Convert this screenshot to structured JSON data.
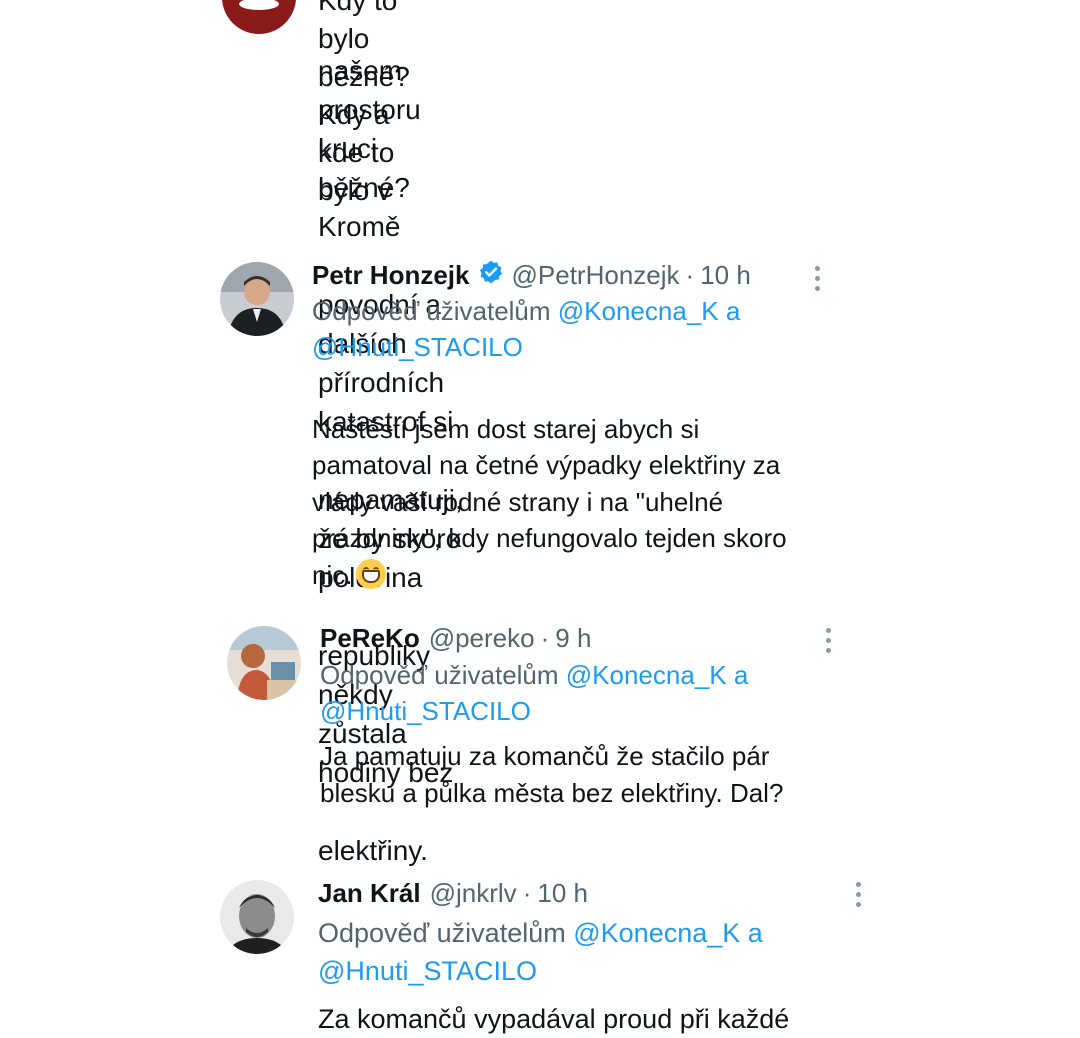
{
  "tweet0": {
    "avatar_label": "STAČILO!",
    "partial_first_line": "Kdy to bylo běžné? Kdy a kde to bylo v",
    "body_lines": [
      "našem prostoru kruci běžné? Kromě",
      "povodní a dalších přírodních katastrof si",
      "nepamatuji, že by skoro polovina",
      "republiky někdy zůstala hodiny bez",
      "elektřiny."
    ]
  },
  "tweet1": {
    "name": "Petr Honzejk",
    "handle": "@PetrHonzejk",
    "dot": "·",
    "time": "10 h",
    "reply_prefix": "Odpověď uživatelům",
    "mention1": "@Konecna_K",
    "conj": "a",
    "mention2": "@Hnuti_STACILO",
    "body": "Naštěstí jsem dost starej abych si\npamatoval na četné výpadky elektřiny za\nvlády vaší rodné strany i na \"uhelné\nprázdniny\", kdy nefungovalo tejden skoro\nnic.",
    "emoji_icon": "grinning-face-emoji"
  },
  "tweet2": {
    "name": "PeReKo",
    "handle": "@pereko",
    "dot": "·",
    "time": "9 h",
    "reply_prefix": "Odpověď uživatelům",
    "mention1": "@Konecna_K",
    "conj": "a",
    "mention2": "@Hnuti_STACILO",
    "body": "Ja pamatuju za komančů že stačilo pár\nblesku a půlka města bez elektřiny. Dal?"
  },
  "tweet3": {
    "name": "Jan Král",
    "handle": "@jnkrlv",
    "dot": "·",
    "time": "10 h",
    "reply_prefix": "Odpověď uživatelům",
    "mention1": "@Konecna_K",
    "conj": "a",
    "mention2": "@Hnuti_STACILO",
    "body_partial": "Za komančů vypadával proud při každé"
  },
  "colors": {
    "text": "#0f1419",
    "secondary": "#536471",
    "link": "#1d9bf0",
    "verified": "#1d9bf0"
  }
}
